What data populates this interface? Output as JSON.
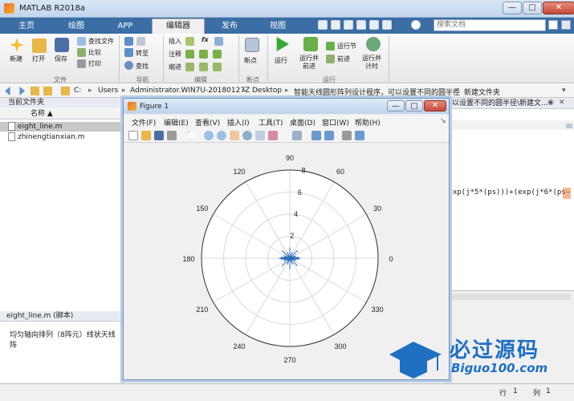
{
  "app": {
    "title": "MATLAB R2018a"
  },
  "window_buttons": {
    "minimize": "—",
    "maximize": "□",
    "close": "✕"
  },
  "ribbon_tabs": [
    {
      "label": "主页"
    },
    {
      "label": "绘图"
    },
    {
      "label": "APP"
    },
    {
      "label": "编辑器"
    },
    {
      "label": "发布"
    },
    {
      "label": "视图"
    }
  ],
  "search": {
    "placeholder": "搜索文档"
  },
  "ribbon": {
    "file": {
      "new": "新建",
      "open": "打开",
      "save": "保存",
      "find_files": "查找文件",
      "compare": "比较",
      "print": "打印",
      "group": "文件"
    },
    "nav": {
      "goto": "转至",
      "find": "查找",
      "group": "导航"
    },
    "edit": {
      "insert": "插入",
      "comment": "注释",
      "indent": "缩进",
      "fx": "fx",
      "group": "编辑"
    },
    "breakpoints": {
      "bp": "断点",
      "group": "断点"
    },
    "run": {
      "run": "运行",
      "run_advance": "运行并\n前进",
      "run_section": "运行节",
      "advance": "前进",
      "run_time": "运行并\n计时",
      "group": "运行"
    }
  },
  "address": {
    "crumbs": [
      "C:",
      "Users",
      "Administrator.WIN7U-20180127Z",
      "Desktop",
      "智能天线圆形阵列设计程序，可以设置不同的圆半径",
      "新建文件夹"
    ]
  },
  "current_folder": {
    "title": "当前文件夹",
    "column": "名称 ▲",
    "files": [
      "eight_line.m",
      "zhinengtianxian.m"
    ]
  },
  "details": {
    "title": "eight_line.m  (脚本)",
    "description": "均匀轴向排列（8阵元）线状天线阵"
  },
  "editor": {
    "path_fragment": "以设置不同的圆半径\\新建文...",
    "code_fragment": "(exp(j*5*(ps)))+(exp(j*6*(ps—"
  },
  "status": {
    "row_label": "行",
    "row_value": "1",
    "col_label": "列",
    "col_value": "1"
  },
  "figure": {
    "title": "Figure 1",
    "menus": [
      "文件(F)",
      "编辑(E)",
      "查看(V)",
      "插入(I)",
      "工具(T)",
      "桌面(D)",
      "窗口(W)",
      "帮助(H)"
    ]
  },
  "chart_data": {
    "type": "polar-line",
    "theta_ticks": [
      0,
      30,
      60,
      90,
      120,
      150,
      180,
      210,
      240,
      270,
      300,
      330
    ],
    "r_ticks": [
      2,
      4,
      6,
      8
    ],
    "r_max": 8,
    "grid": true,
    "series_color": "#2b6fb5",
    "pattern": {
      "lobes": [
        {
          "theta_deg": 0,
          "r": 8
        },
        {
          "theta_deg": 180,
          "r": 8
        },
        {
          "theta_deg": 90,
          "r": 1
        },
        {
          "theta_deg": 270,
          "r": 1
        }
      ]
    }
  },
  "watermark": {
    "cn": "必过源码",
    "url": "Biguo100.com"
  },
  "colors": {
    "ribbon": "#3a6ea5",
    "accent": "#2b6fb5"
  }
}
